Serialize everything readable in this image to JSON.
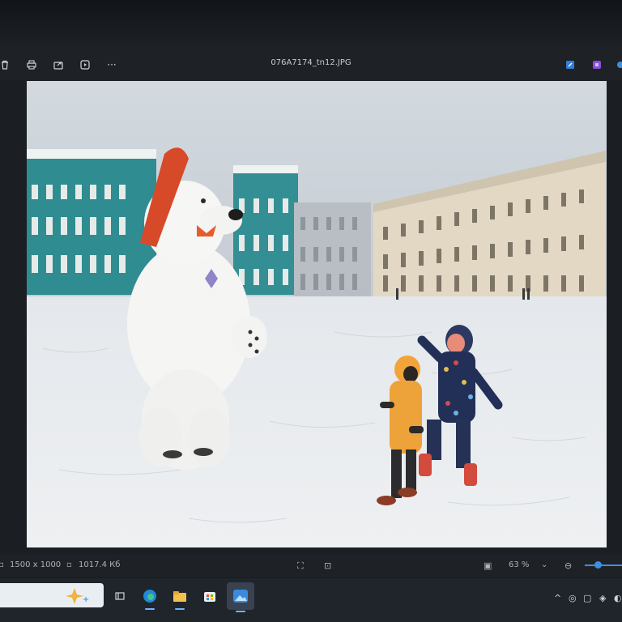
{
  "window": {
    "filename": "076A7174_tn12.JPG"
  },
  "toolbar": {
    "left_icons": [
      "delete-icon",
      "print-icon",
      "share-icon",
      "slideshow-icon",
      "more-icon"
    ],
    "more_label": "···",
    "right_icons": [
      "edit-icon",
      "app-icon"
    ]
  },
  "status": {
    "dimensions": "1500 x 1000",
    "filesize": "1017.4 Кб",
    "zoom": "63 %",
    "zoom_fraction": 0.2
  },
  "taskbar": {
    "apps": [
      "widgets-icon",
      "edge-icon",
      "file-explorer-icon",
      "store-icon",
      "photos-icon"
    ],
    "tray_chevron": "^"
  },
  "colors": {
    "accent": "#3d8fe0",
    "chrome": "#1e2227"
  }
}
